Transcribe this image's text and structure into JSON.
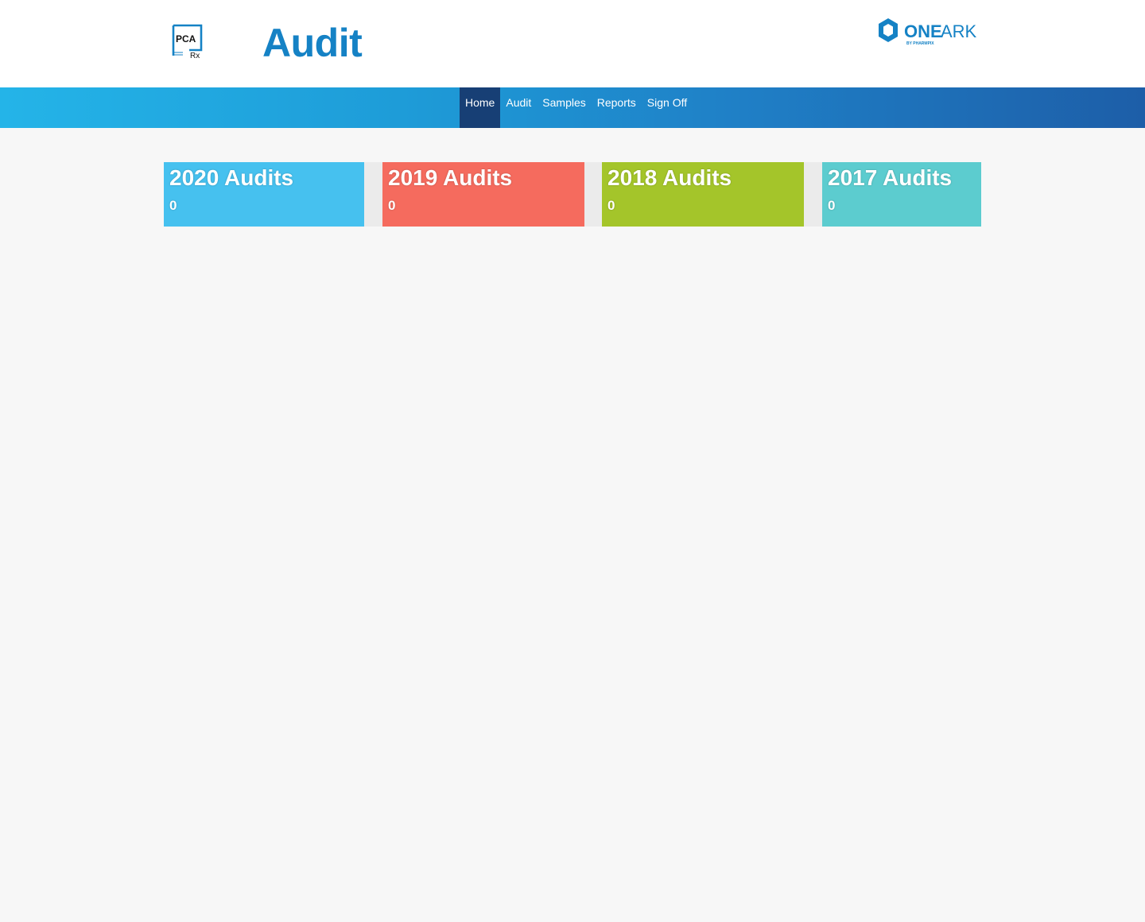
{
  "header": {
    "title": "Audit",
    "pca_logo": {
      "icon": "pca-rx-logo",
      "text": "PCA",
      "rx_text": "Rx",
      "color": "#1582c5"
    },
    "oneark_logo": {
      "icon": "oneark-hexagon-logo",
      "text_one": "ONE",
      "text_ark": "ARK",
      "byline": "BY PHARMPIX",
      "color": "#1582c5"
    }
  },
  "nav": {
    "items": [
      {
        "label": "Home",
        "active": true
      },
      {
        "label": "Audit",
        "active": false
      },
      {
        "label": "Samples",
        "active": false
      },
      {
        "label": "Reports",
        "active": false
      },
      {
        "label": "Sign Off",
        "active": false
      }
    ],
    "active_color": "#173f75"
  },
  "tiles": [
    {
      "title": "2020 Audits",
      "count": "0",
      "color": "#46c1ef"
    },
    {
      "title": "2019 Audits",
      "count": "0",
      "color": "#f56b5e"
    },
    {
      "title": "2018 Audits",
      "count": "0",
      "color": "#a4c52a"
    },
    {
      "title": "2017 Audits",
      "count": "0",
      "color": "#5ccccf"
    }
  ]
}
